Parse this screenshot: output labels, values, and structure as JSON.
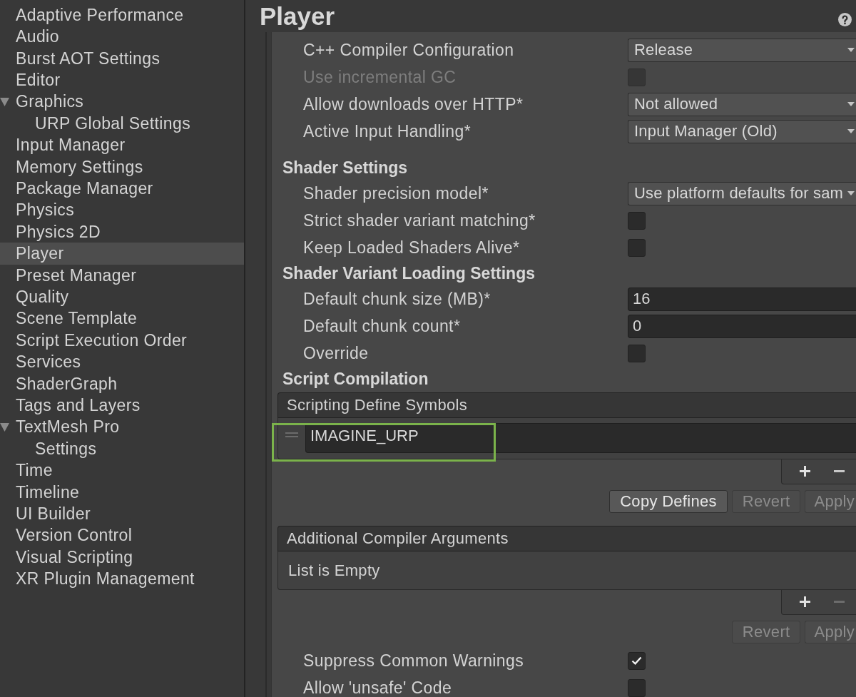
{
  "sidebar": {
    "items": [
      {
        "label": "Adaptive Performance",
        "selected": false
      },
      {
        "label": "Audio",
        "selected": false
      },
      {
        "label": "Burst AOT Settings",
        "selected": false
      },
      {
        "label": "Editor",
        "selected": false
      },
      {
        "label": "Graphics",
        "selected": false,
        "expanded": true,
        "children": [
          {
            "label": "URP Global Settings",
            "selected": false
          }
        ]
      },
      {
        "label": "Input Manager",
        "selected": false
      },
      {
        "label": "Memory Settings",
        "selected": false
      },
      {
        "label": "Package Manager",
        "selected": false
      },
      {
        "label": "Physics",
        "selected": false
      },
      {
        "label": "Physics 2D",
        "selected": false
      },
      {
        "label": "Player",
        "selected": true
      },
      {
        "label": "Preset Manager",
        "selected": false
      },
      {
        "label": "Quality",
        "selected": false
      },
      {
        "label": "Scene Template",
        "selected": false
      },
      {
        "label": "Script Execution Order",
        "selected": false
      },
      {
        "label": "Services",
        "selected": false
      },
      {
        "label": "ShaderGraph",
        "selected": false
      },
      {
        "label": "Tags and Layers",
        "selected": false
      },
      {
        "label": "TextMesh Pro",
        "selected": false,
        "expanded": true,
        "children": [
          {
            "label": "Settings",
            "selected": false
          }
        ]
      },
      {
        "label": "Time",
        "selected": false
      },
      {
        "label": "Timeline",
        "selected": false
      },
      {
        "label": "UI Builder",
        "selected": false
      },
      {
        "label": "Version Control",
        "selected": false
      },
      {
        "label": "Visual Scripting",
        "selected": false
      },
      {
        "label": "XR Plugin Management",
        "selected": false
      }
    ]
  },
  "inspector": {
    "title": "Player",
    "rows": [
      {
        "kind": "dropdown",
        "label": "C++ Compiler Configuration",
        "value": "Release",
        "disabled": false
      },
      {
        "kind": "checkbox",
        "label": "Use incremental GC",
        "checked": false,
        "disabled": true
      },
      {
        "kind": "dropdown",
        "label": "Allow downloads over HTTP*",
        "value": "Not allowed",
        "disabled": false
      },
      {
        "kind": "dropdown",
        "label": "Active Input Handling*",
        "value": "Input Manager (Old)",
        "disabled": false
      },
      {
        "kind": "section",
        "label": "Shader Settings"
      },
      {
        "kind": "dropdown",
        "label": "Shader precision model*",
        "value": "Use platform defaults for sam",
        "disabled": false
      },
      {
        "kind": "checkbox",
        "label": "Strict shader variant matching*",
        "checked": false,
        "disabled": false
      },
      {
        "kind": "checkbox",
        "label": "Keep Loaded Shaders Alive*",
        "checked": false,
        "disabled": false
      },
      {
        "kind": "section",
        "label": "Shader Variant Loading Settings"
      },
      {
        "kind": "field",
        "label": "Default chunk size (MB)*",
        "value": "16",
        "disabled": false
      },
      {
        "kind": "field",
        "label": "Default chunk count*",
        "value": "0",
        "disabled": false
      },
      {
        "kind": "checkbox",
        "label": "Override",
        "checked": false,
        "disabled": false
      },
      {
        "kind": "section",
        "label": "Script Compilation"
      },
      {
        "kind": "list",
        "header": "Scripting Define Symbols",
        "items": [
          {
            "value": "IMAGINE_URP",
            "highlighted": true
          }
        ],
        "remove_disabled": false,
        "buttons": [
          {
            "label": "Copy Defines",
            "disabled": false
          },
          {
            "label": "Revert",
            "disabled": true
          },
          {
            "label": "Apply",
            "disabled": true
          }
        ]
      },
      {
        "kind": "list",
        "header": "Additional Compiler Arguments",
        "empty_text": "List is Empty",
        "remove_disabled": true,
        "buttons": [
          {
            "label": "Revert",
            "disabled": true
          },
          {
            "label": "Apply",
            "disabled": true
          }
        ]
      },
      {
        "kind": "checkbox",
        "label": "Suppress Common Warnings",
        "checked": true,
        "disabled": false
      },
      {
        "kind": "checkbox",
        "label": "Allow 'unsafe' Code",
        "checked": false,
        "disabled": false
      }
    ]
  }
}
